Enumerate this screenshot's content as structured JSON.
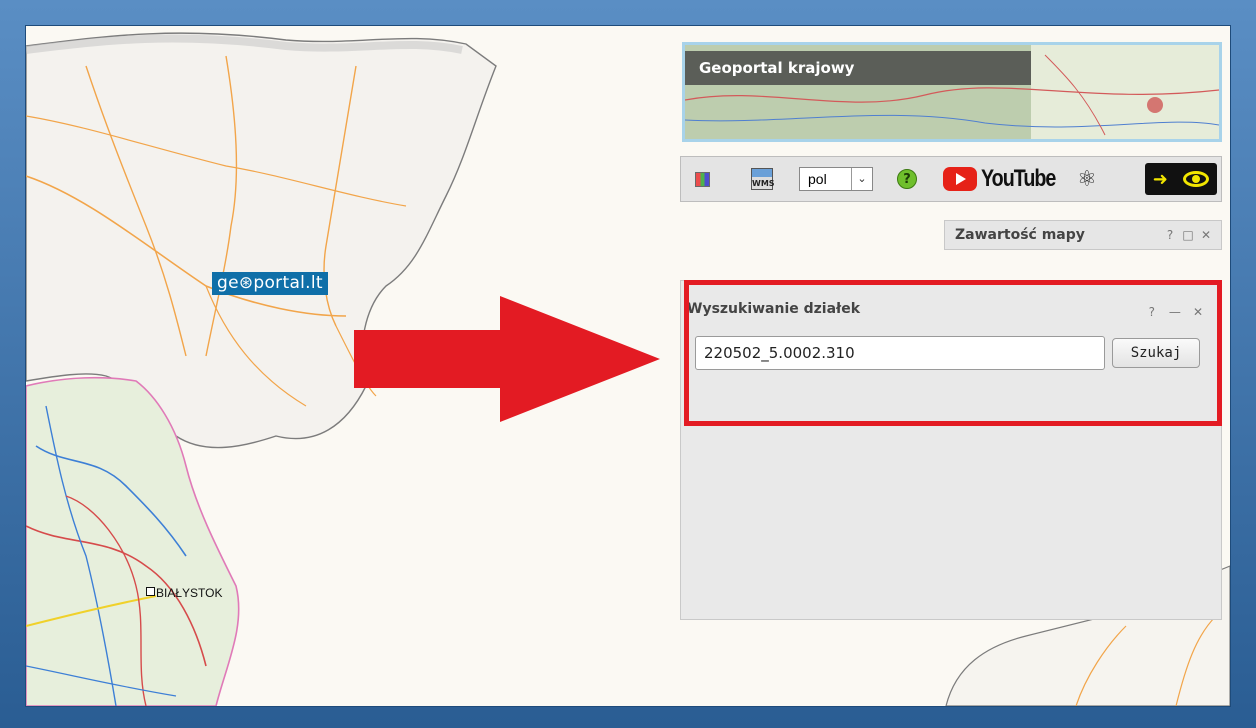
{
  "map": {
    "logo_text": "ge⊛portal.lt",
    "city_label": "BIAŁYSTOK"
  },
  "krajowy": {
    "title": "Geoportal krajowy"
  },
  "toolbar": {
    "language_value": "pol",
    "help_label": "?",
    "youtube_label": "YouTube",
    "wms_label": "WMS"
  },
  "zawartosc": {
    "title": "Zawartość mapy",
    "help": "?",
    "maximize": "□",
    "close": "✕"
  },
  "search_panel": {
    "title": "Wyszukiwanie działek",
    "help": "?",
    "minimize": "—",
    "close": "✕",
    "input_value": "220502_5.0002.310",
    "button_label": "Szukaj"
  },
  "colors": {
    "highlight": "#e31b23",
    "logo_bg": "#0f6fa8"
  }
}
